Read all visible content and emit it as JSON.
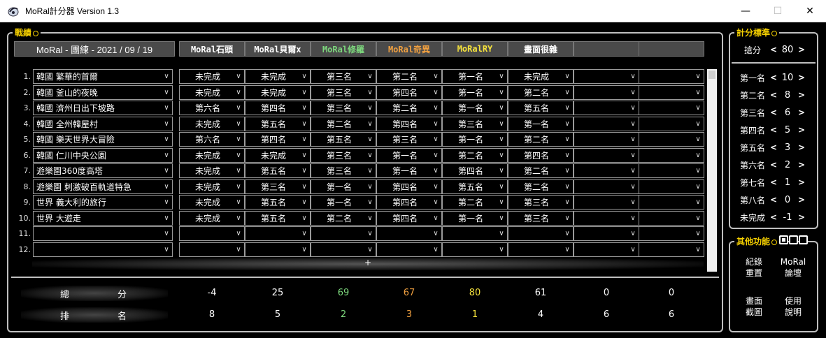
{
  "window": {
    "title": "MoRal計分器 Version 1.3",
    "minimize": "—",
    "maximize": "☐",
    "close": "✕"
  },
  "groups": {
    "record": "戰績",
    "scoring": "計分標準",
    "other": "其他功能"
  },
  "header": {
    "event_title": "MoRal - 團練 - 2021 / 09 / 19",
    "players": [
      {
        "name": "MoRal石頭",
        "color": "#ffffff"
      },
      {
        "name": "MoRal貝爾x",
        "color": "#ffffff"
      },
      {
        "name": "MoRal修羅",
        "color": "#7dd87d"
      },
      {
        "name": "MoRal奇異",
        "color": "#f0a040"
      },
      {
        "name": "MoRalRY",
        "color": "#f5e23c"
      },
      {
        "name": "畫面很雜",
        "color": "#ffffff"
      },
      {
        "name": "",
        "color": "#ffffff"
      },
      {
        "name": "",
        "color": "#ffffff"
      }
    ]
  },
  "rows": [
    {
      "num": "1.",
      "stage": "韓國 繁華的首爾",
      "results": [
        "未完成",
        "未完成",
        "第三名",
        "第二名",
        "第一名",
        "未完成",
        "",
        ""
      ]
    },
    {
      "num": "2.",
      "stage": "韓國 釜山的夜晚",
      "results": [
        "未完成",
        "未完成",
        "第三名",
        "第四名",
        "第一名",
        "第二名",
        "",
        ""
      ]
    },
    {
      "num": "3.",
      "stage": "韓國 濟州日出下坡路",
      "results": [
        "第六名",
        "第四名",
        "第三名",
        "第二名",
        "第一名",
        "第五名",
        "",
        ""
      ]
    },
    {
      "num": "4.",
      "stage": "韓國 全州韓屋村",
      "results": [
        "未完成",
        "第五名",
        "第二名",
        "第四名",
        "第三名",
        "第一名",
        "",
        ""
      ]
    },
    {
      "num": "5.",
      "stage": "韓國 樂天世界大冒險",
      "results": [
        "第六名",
        "第四名",
        "第五名",
        "第三名",
        "第一名",
        "第二名",
        "",
        ""
      ]
    },
    {
      "num": "6.",
      "stage": "韓國 仁川中央公園",
      "results": [
        "未完成",
        "未完成",
        "第三名",
        "第一名",
        "第二名",
        "第四名",
        "",
        ""
      ]
    },
    {
      "num": "7.",
      "stage": "遊樂園360度高塔",
      "results": [
        "未完成",
        "第五名",
        "第三名",
        "第一名",
        "第四名",
        "第二名",
        "",
        ""
      ]
    },
    {
      "num": "8.",
      "stage": "遊樂園 刺激破百軌道特急",
      "results": [
        "未完成",
        "第三名",
        "第一名",
        "第四名",
        "第五名",
        "第二名",
        "",
        ""
      ]
    },
    {
      "num": "9.",
      "stage": "世界 義大利的旅行",
      "results": [
        "未完成",
        "第五名",
        "第一名",
        "第四名",
        "第二名",
        "第三名",
        "",
        ""
      ]
    },
    {
      "num": "10.",
      "stage": "世界 大遊走",
      "results": [
        "未完成",
        "第五名",
        "第二名",
        "第四名",
        "第一名",
        "第三名",
        "",
        ""
      ]
    },
    {
      "num": "11.",
      "stage": "",
      "results": [
        "",
        "",
        "",
        "",
        "",
        "",
        "",
        ""
      ]
    },
    {
      "num": "12.",
      "stage": "",
      "results": [
        "",
        "",
        "",
        "",
        "",
        "",
        "",
        ""
      ]
    }
  ],
  "add_row": "+",
  "totals": {
    "score_label_a": "總",
    "score_label_b": "分",
    "rank_label_a": "排",
    "rank_label_b": "名",
    "scores": [
      "-4",
      "25",
      "69",
      "67",
      "80",
      "61",
      "0",
      "0"
    ],
    "ranks": [
      "8",
      "5",
      "2",
      "3",
      "1",
      "4",
      "6",
      "6"
    ]
  },
  "scoring": {
    "grab_label": "搶分",
    "grab_value": "80",
    "ranks": [
      {
        "label": "第一名",
        "value": "10"
      },
      {
        "label": "第二名",
        "value": "8"
      },
      {
        "label": "第三名",
        "value": "6"
      },
      {
        "label": "第四名",
        "value": "5"
      },
      {
        "label": "第五名",
        "value": "3"
      },
      {
        "label": "第六名",
        "value": "2"
      },
      {
        "label": "第七名",
        "value": "1"
      },
      {
        "label": "第八名",
        "value": "0"
      },
      {
        "label": "未完成",
        "value": "-1"
      }
    ],
    "dec": "<",
    "inc": ">"
  },
  "functions": {
    "reset_l1": "紀錄",
    "reset_l2": "重置",
    "forum_l1": "MoRal",
    "forum_l2": "論壇",
    "capture_l1": "畫面",
    "capture_l2": "截圖",
    "help_l1": "使用",
    "help_l2": "說明"
  },
  "chevron": "∨"
}
